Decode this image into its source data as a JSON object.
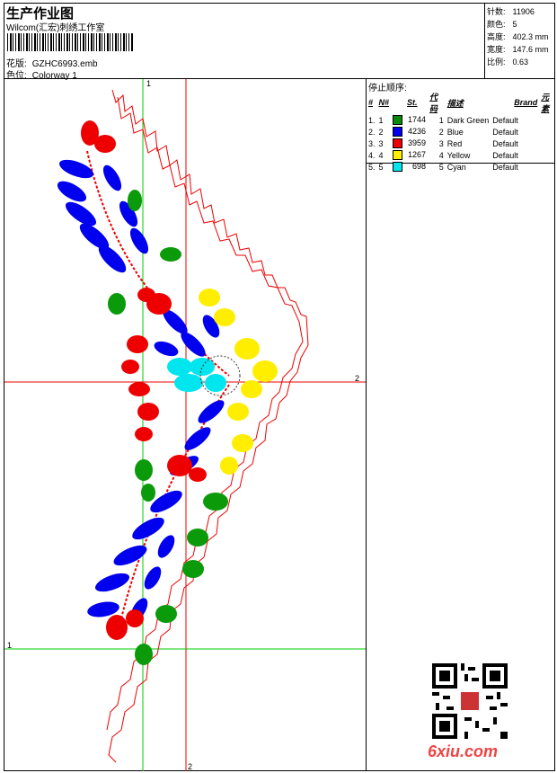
{
  "header": {
    "title": "生产作业图",
    "subtitle": "Wilcom(汇宏)刺绣工作室",
    "design_label": "花版:",
    "design_value": "GZHC6993.emb",
    "colorway_label": "色位:",
    "colorway_value": "Colorway 1"
  },
  "stats": {
    "stitches_label": "针数:",
    "stitches_value": "11906",
    "colors_label": "颜色:",
    "colors_value": "5",
    "height_label": "高度:",
    "height_value": "402.3 mm",
    "width_label": "宽度:",
    "width_value": "147.6 mm",
    "scale_label": "比例:",
    "scale_value": "0.63"
  },
  "sequence": {
    "title": "停止顺序:",
    "headers": [
      "#",
      "N#",
      "St.",
      "代码",
      "描述",
      "Brand",
      "元素"
    ],
    "rows": [
      {
        "num": "1.",
        "n": "1",
        "color": "#0a8a0a",
        "st": "1744",
        "code": "1",
        "desc": "Dark Green",
        "brand": "Default"
      },
      {
        "num": "2.",
        "n": "2",
        "color": "#0000ee",
        "st": "4236",
        "code": "2",
        "desc": "Blue",
        "brand": "Default"
      },
      {
        "num": "3.",
        "n": "3",
        "color": "#ee0000",
        "st": "3959",
        "code": "3",
        "desc": "Red",
        "brand": "Default"
      },
      {
        "num": "4.",
        "n": "4",
        "color": "#ffee00",
        "st": "1267",
        "code": "4",
        "desc": "Yellow",
        "brand": "Default"
      },
      {
        "num": "5.",
        "n": "5",
        "color": "#00e5ee",
        "st": "698",
        "code": "5",
        "desc": "Cyan",
        "brand": "Default"
      }
    ]
  },
  "axes": {
    "v1": "1",
    "h2": "2",
    "h1": "1",
    "v2": "2"
  },
  "watermark": "6xiu.com",
  "qr_stamp": "汇宏"
}
